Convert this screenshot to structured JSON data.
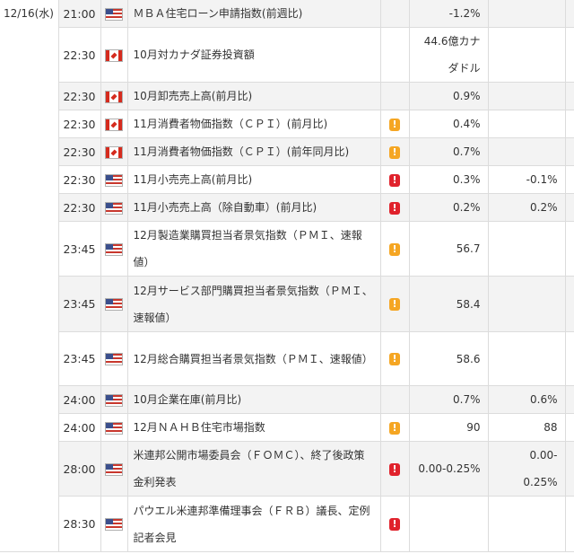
{
  "colors": {
    "row_alt": "#f3f3f3",
    "imp_medium": "#f5a623",
    "imp_high": "#e0222c"
  },
  "date": "12/16(水)",
  "rows": [
    {
      "time": "21:00",
      "flag": "us-flag-icon",
      "name": "ＭＢＡ住宅ローン申請指数(前週比)",
      "importance": "",
      "previous": "-1.2%",
      "forecast": ""
    },
    {
      "time": "22:30",
      "flag": "canada-flag-icon",
      "name": "10月対カナダ証券投資額",
      "importance": "",
      "previous": "44.6億カナダドル",
      "forecast": ""
    },
    {
      "time": "22:30",
      "flag": "canada-flag-icon",
      "name": "10月卸売売上高(前月比)",
      "importance": "",
      "previous": "0.9%",
      "forecast": ""
    },
    {
      "time": "22:30",
      "flag": "canada-flag-icon",
      "name": "11月消費者物価指数（ＣＰＩ）(前月比)",
      "importance": "medium",
      "previous": "0.4%",
      "forecast": ""
    },
    {
      "time": "22:30",
      "flag": "canada-flag-icon",
      "name": "11月消費者物価指数（ＣＰＩ）(前年同月比)",
      "importance": "medium",
      "previous": "0.7%",
      "forecast": ""
    },
    {
      "time": "22:30",
      "flag": "us-flag-icon",
      "name": "11月小売売上高(前月比)",
      "importance": "high",
      "previous": "0.3%",
      "forecast": "-0.1%"
    },
    {
      "time": "22:30",
      "flag": "us-flag-icon",
      "name": "11月小売売上高（除自動車）(前月比)",
      "importance": "high",
      "previous": "0.2%",
      "forecast": "0.2%"
    },
    {
      "time": "23:45",
      "flag": "us-flag-icon",
      "name": "12月製造業購買担当者景気指数（ＰＭＩ、速報値）",
      "importance": "medium",
      "previous": "56.7",
      "forecast": ""
    },
    {
      "time": "23:45",
      "flag": "us-flag-icon",
      "name": "12月サービス部門購買担当者景気指数（ＰＭＩ、速報値）",
      "importance": "medium",
      "previous": "58.4",
      "forecast": ""
    },
    {
      "time": "23:45",
      "flag": "us-flag-icon",
      "name": "12月総合購買担当者景気指数（ＰＭＩ、速報値）",
      "importance": "medium",
      "previous": "58.6",
      "forecast": ""
    },
    {
      "time": "24:00",
      "flag": "us-flag-icon",
      "name": "10月企業在庫(前月比)",
      "importance": "",
      "previous": "0.7%",
      "forecast": "0.6%"
    },
    {
      "time": "24:00",
      "flag": "us-flag-icon",
      "name": "12月ＮＡＨＢ住宅市場指数",
      "importance": "medium",
      "previous": "90",
      "forecast": "88"
    },
    {
      "time": "28:00",
      "flag": "us-flag-icon",
      "name": "米連邦公開市場委員会（ＦＯＭＣ）、終了後政策金利発表",
      "importance": "high",
      "previous": "0.00-0.25%",
      "forecast": "0.00-0.25%"
    },
    {
      "time": "28:30",
      "flag": "us-flag-icon",
      "name": "パウエル米連邦準備理事会（ＦＲＢ）議長、定例記者会見",
      "importance": "high",
      "previous": "",
      "forecast": ""
    }
  ]
}
